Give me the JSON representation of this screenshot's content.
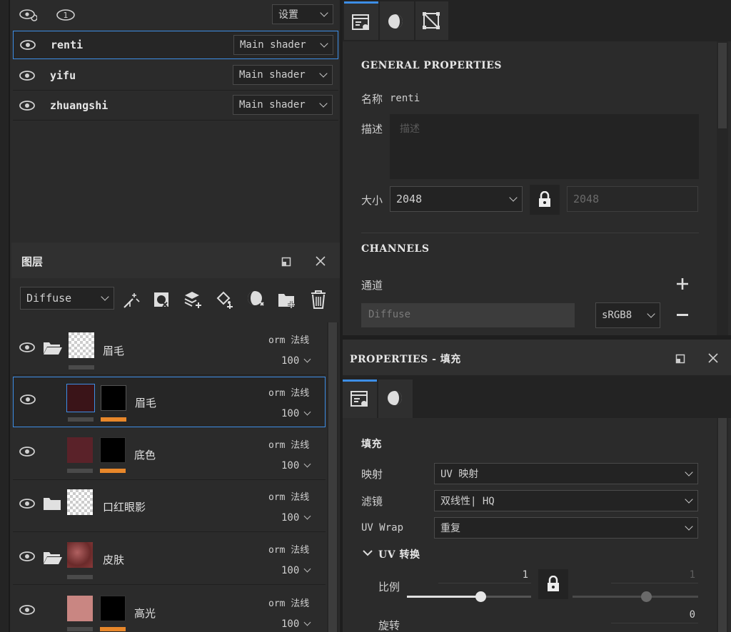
{
  "texture_sets": {
    "settings_label": "设置",
    "items": [
      {
        "name": "renti",
        "shader": "Main shader"
      },
      {
        "name": "yifu",
        "shader": "Main shader"
      },
      {
        "name": "zhuangshi",
        "shader": "Main shader"
      }
    ]
  },
  "layers_panel": {
    "title": "图层",
    "channel_select": "Diffuse",
    "layers": [
      {
        "name": "眉毛",
        "blend": "orm 法线",
        "opacity": "100",
        "kind": "folder"
      },
      {
        "name": "眉毛",
        "blend": "orm 法线",
        "opacity": "100",
        "kind": "fill"
      },
      {
        "name": "底色",
        "blend": "orm 法线",
        "opacity": "100",
        "kind": "fill"
      },
      {
        "name": "口红眼影",
        "blend": "orm 法线",
        "opacity": "100",
        "kind": "folder"
      },
      {
        "name": "皮肤",
        "blend": "orm 法线",
        "opacity": "100",
        "kind": "folder"
      },
      {
        "name": "高光",
        "blend": "orm 法线",
        "opacity": "100",
        "kind": "fill"
      }
    ]
  },
  "texture_set_settings": {
    "general_title": "GENERAL PROPERTIES",
    "name_label": "名称",
    "name_value": "renti",
    "desc_label": "描述",
    "desc_placeholder": "描述",
    "size_label": "大小",
    "size_value": "2048",
    "size_value_locked": "2048",
    "channels_title": "CHANNELS",
    "channel_label": "通道",
    "channel_name": "Diffuse",
    "channel_format": "sRGB8"
  },
  "properties_panel": {
    "title": "PROPERTIES - 填充",
    "fill_title": "填充",
    "mapping_label": "映射",
    "mapping_value": "UV 映射",
    "filter_label": "滤镜",
    "filter_value": "双线性| HQ",
    "uvwrap_label": "UV Wrap",
    "uvwrap_value": "重复",
    "uv_transform_title": "UV 转换",
    "scale_label": "比例",
    "scale_value": "1",
    "scale_value_locked": "1",
    "rotate_label": "旋转",
    "rotate_value": "0"
  },
  "colors": {
    "accent_blue": "#3d8ee6",
    "accent_orange": "#e8872a",
    "panel_bg": "#2b2b2b"
  }
}
